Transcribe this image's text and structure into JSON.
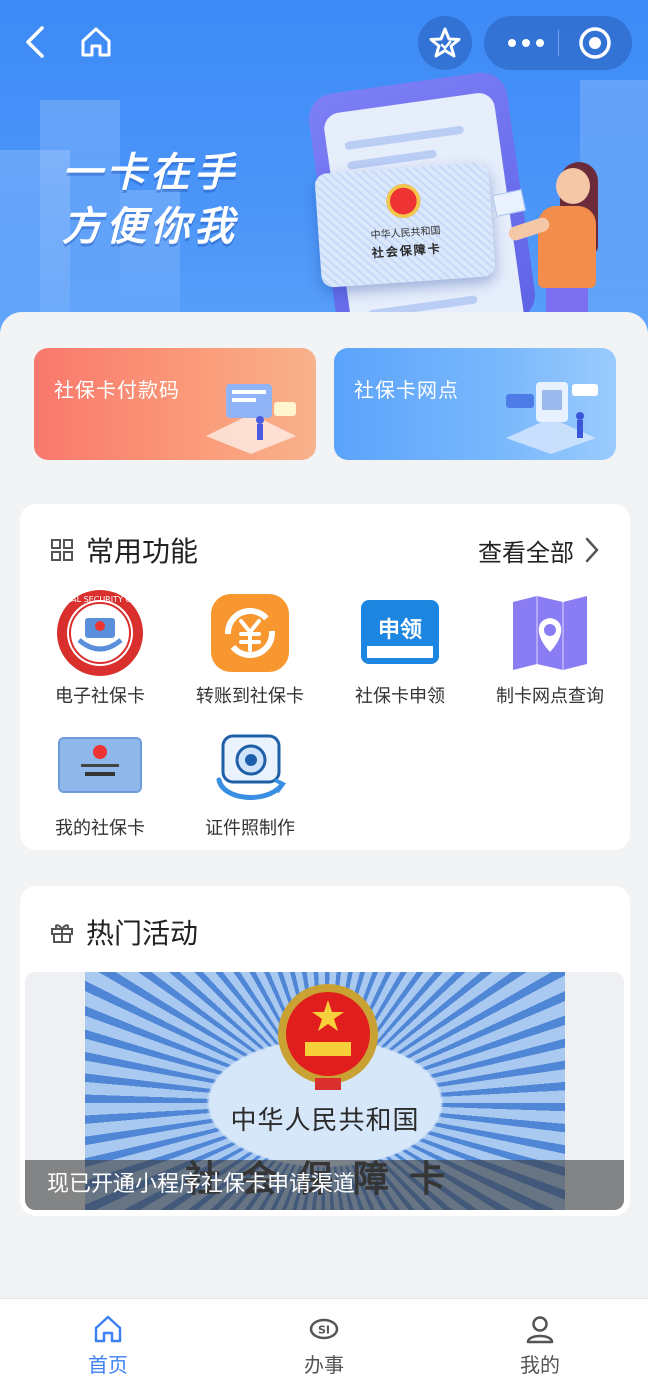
{
  "hero": {
    "slogan_line1": "一卡在手",
    "slogan_line2": "方便你我",
    "card_country": "中华人民共和国",
    "card_name": "社会保障卡"
  },
  "nav": {
    "back_icon": "chevron-left-icon",
    "home_icon": "home-icon",
    "favorite_icon": "star-icon",
    "more_icon": "more-dots-icon",
    "close_icon": "target-circle-icon"
  },
  "promos": [
    {
      "label": "社保卡付款码"
    },
    {
      "label": "社保卡网点"
    }
  ],
  "functions": {
    "title": "常用功能",
    "see_all": "查看全部",
    "items": [
      {
        "label": "电子社保卡",
        "icon": "social-security-badge-icon"
      },
      {
        "label": "转账到社保卡",
        "icon": "yuan-transfer-icon"
      },
      {
        "label": "社保卡申领",
        "icon": "apply-card-icon",
        "icon_text": "申领"
      },
      {
        "label": "制卡网点查询",
        "icon": "map-pin-icon"
      },
      {
        "label": "我的社保卡",
        "icon": "card-icon"
      },
      {
        "label": "证件照制作",
        "icon": "camera-icon"
      }
    ]
  },
  "activities": {
    "title": "热门活动",
    "banner_country": "中华人民共和国",
    "banner_card_name": "社会保障卡",
    "caption": "现已开通小程序社保卡申请渠道"
  },
  "tabbar": {
    "active_color": "#3c82f3",
    "items": [
      {
        "label": "首页",
        "icon": "home-icon",
        "active": true
      },
      {
        "label": "办事",
        "icon": "si-logo-icon",
        "active": false
      },
      {
        "label": "我的",
        "icon": "user-icon",
        "active": false
      }
    ]
  }
}
